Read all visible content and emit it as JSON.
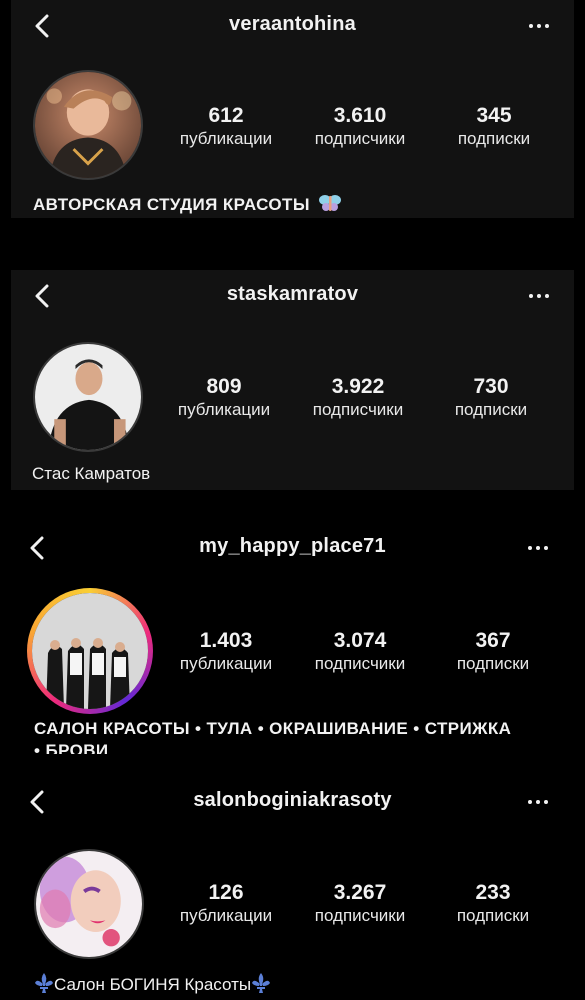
{
  "stats_labels": {
    "posts": "публикации",
    "followers": "подписчики",
    "following": "подписки"
  },
  "profiles": [
    {
      "username": "veraantohina",
      "posts": "612",
      "followers": "3.610",
      "following": "345",
      "bio": "АВТОРСКАЯ СТУДИЯ КРАСОТЫ",
      "bio_emoji": "fairy-icon"
    },
    {
      "username": "staskamratov",
      "posts": "809",
      "followers": "3.922",
      "following": "730",
      "bio": "Стас Камратов"
    },
    {
      "username": "my_happy_place71",
      "posts": "1.403",
      "followers": "3.074",
      "following": "367",
      "bio": "САЛОН КРАСОТЫ • ТУЛА • ОКРАШИВАНИЕ • СТРИЖКА",
      "bio_cut": "• БРОВИ",
      "story_ring": true
    },
    {
      "username": "salonboginiakrasoty",
      "posts": "126",
      "followers": "3.267",
      "following": "233",
      "bio": "Салон БОГИНЯ Красоты",
      "bio_emoji": "fleur-de-lis-icon"
    }
  ],
  "colors": {
    "background": "#000000",
    "card": "#121212",
    "text": "#f2f2f2",
    "emoji_fleur": "#5b7fd6"
  }
}
